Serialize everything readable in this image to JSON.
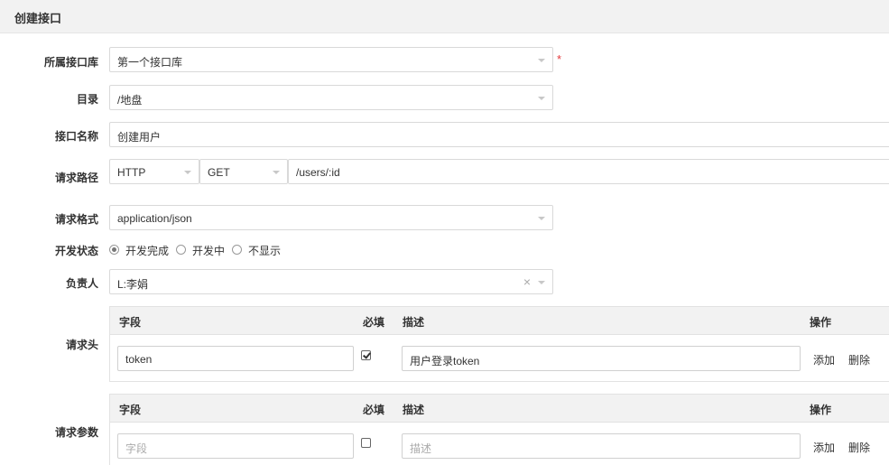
{
  "header": {
    "title": "创建接口"
  },
  "form": {
    "library": {
      "label": "所属接口库",
      "value": "第一个接口库",
      "required_mark": "*"
    },
    "directory": {
      "label": "目录",
      "value": "/地盘"
    },
    "api_name": {
      "label": "接口名称",
      "value": "创建用户"
    },
    "request_path": {
      "label": "请求路径",
      "protocol": "HTTP",
      "method": "GET",
      "path": "/users/:id"
    },
    "request_format": {
      "label": "请求格式",
      "value": "application/json"
    },
    "dev_status": {
      "label": "开发状态",
      "options": [
        "开发完成",
        "开发中",
        "不显示"
      ],
      "selected": "开发完成"
    },
    "owner": {
      "label": "负责人",
      "value": "L:李娟",
      "clear_icon": "×"
    }
  },
  "headers_table": {
    "label": "请求头",
    "columns": {
      "field": "字段",
      "required": "必填",
      "desc": "描述",
      "actions": "操作"
    },
    "rows": [
      {
        "field": "token",
        "required": true,
        "desc": "用户登录token",
        "add": "添加",
        "delete": "删除"
      }
    ]
  },
  "params_table": {
    "label": "请求参数",
    "columns": {
      "field": "字段",
      "required": "必填",
      "desc": "描述",
      "actions": "操作"
    },
    "rows": [
      {
        "field_placeholder": "字段",
        "required": false,
        "desc_placeholder": "描述",
        "add": "添加",
        "delete": "删除"
      }
    ]
  }
}
